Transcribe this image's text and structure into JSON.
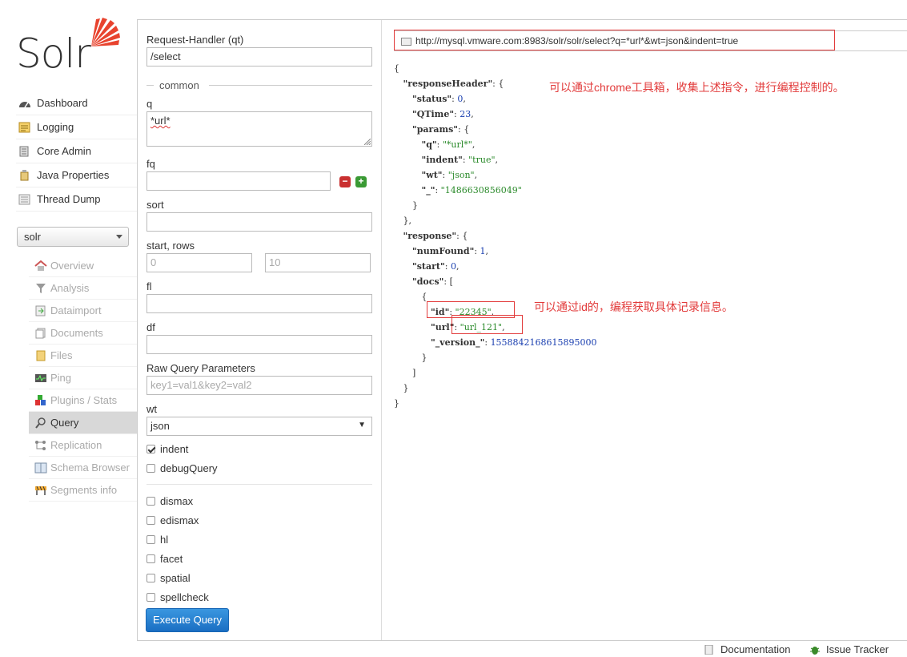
{
  "logo": {
    "text": "Solr"
  },
  "main_nav": [
    {
      "label": "Dashboard",
      "icon": "dashboard-icon"
    },
    {
      "label": "Logging",
      "icon": "logging-icon"
    },
    {
      "label": "Core Admin",
      "icon": "core-admin-icon"
    },
    {
      "label": "Java Properties",
      "icon": "java-icon"
    },
    {
      "label": "Thread Dump",
      "icon": "thread-dump-icon"
    }
  ],
  "core_selector": {
    "value": "solr"
  },
  "core_nav": [
    {
      "label": "Overview",
      "icon": "home-icon"
    },
    {
      "label": "Analysis",
      "icon": "filter-icon"
    },
    {
      "label": "Dataimport",
      "icon": "dataimport-icon"
    },
    {
      "label": "Documents",
      "icon": "documents-icon"
    },
    {
      "label": "Files",
      "icon": "files-icon"
    },
    {
      "label": "Ping",
      "icon": "ping-icon"
    },
    {
      "label": "Plugins / Stats",
      "icon": "plugins-icon"
    },
    {
      "label": "Query",
      "icon": "search-icon",
      "active": true
    },
    {
      "label": "Replication",
      "icon": "replication-icon"
    },
    {
      "label": "Schema Browser",
      "icon": "schema-icon"
    },
    {
      "label": "Segments info",
      "icon": "segments-icon"
    }
  ],
  "form": {
    "handler_label": "Request-Handler (qt)",
    "handler_value": "/select",
    "common_label": "common",
    "q_label": "q",
    "q_value": "*url*",
    "fq_label": "fq",
    "fq_value": "",
    "sort_label": "sort",
    "sort_value": "",
    "start_rows_label": "start, rows",
    "start_placeholder": "0",
    "rows_placeholder": "10",
    "fl_label": "fl",
    "fl_value": "",
    "df_label": "df",
    "df_value": "",
    "raw_label": "Raw Query Parameters",
    "raw_placeholder": "key1=val1&key2=val2",
    "wt_label": "wt",
    "wt_value": "json",
    "indent_label": "indent",
    "debug_label": "debugQuery",
    "dismax_label": "dismax",
    "edismax_label": "edismax",
    "hl_label": "hl",
    "facet_label": "facet",
    "spatial_label": "spatial",
    "spellcheck_label": "spellcheck",
    "execute_label": "Execute Query"
  },
  "result": {
    "url": "http://mysql.vmware.com:8983/solr/solr/select?q=*url*&wt=json&indent=true",
    "lines": [
      {
        "indent": 0,
        "text": "{"
      },
      {
        "indent": 1,
        "key": "\"responseHeader\"",
        "sep": ": {"
      },
      {
        "indent": 2,
        "key": "\"status\"",
        "sep": ": ",
        "num": "0",
        "end": ","
      },
      {
        "indent": 2,
        "key": "\"QTime\"",
        "sep": ": ",
        "num": "23",
        "end": ","
      },
      {
        "indent": 2,
        "key": "\"params\"",
        "sep": ": {"
      },
      {
        "indent": 3,
        "key": "\"q\"",
        "sep": ": ",
        "str": "\"*url*\"",
        "end": ","
      },
      {
        "indent": 3,
        "key": "\"indent\"",
        "sep": ": ",
        "str": "\"true\"",
        "end": ","
      },
      {
        "indent": 3,
        "key": "\"wt\"",
        "sep": ": ",
        "str": "\"json\"",
        "end": ","
      },
      {
        "indent": 3,
        "key": "\"_\"",
        "sep": ": ",
        "str": "\"1486630856049\""
      },
      {
        "indent": 2,
        "text": "}"
      },
      {
        "indent": 1,
        "text": "},"
      },
      {
        "indent": 1,
        "key": "\"response\"",
        "sep": ": {"
      },
      {
        "indent": 2,
        "key": "\"numFound\"",
        "sep": ": ",
        "num": "1",
        "end": ","
      },
      {
        "indent": 2,
        "key": "\"start\"",
        "sep": ": ",
        "num": "0",
        "end": ","
      },
      {
        "indent": 2,
        "key": "\"docs\"",
        "sep": ": ["
      },
      {
        "indent": 3,
        "text": "{"
      },
      {
        "indent": 4,
        "key": "\"id\"",
        "sep": ": ",
        "str": "\"22345\"",
        "end": ","
      },
      {
        "indent": 4,
        "key": "\"url\"",
        "sep": ": ",
        "str": "\"url_121\"",
        "end": ","
      },
      {
        "indent": 4,
        "key": "\"_version_\"",
        "sep": ": ",
        "num": "1558842168615895000"
      },
      {
        "indent": 3,
        "text": "}"
      },
      {
        "indent": 2,
        "text": "]"
      },
      {
        "indent": 1,
        "text": "}"
      },
      {
        "indent": 0,
        "text": "}"
      }
    ]
  },
  "annotations": {
    "note1": "可以通过chrome工具箱，收集上述指令，进行编程控制的。",
    "note2": "可以通过id的，编程获取具体记录信息。"
  },
  "footer": {
    "documentation": "Documentation",
    "issue_tracker": "Issue Tracker"
  },
  "colors": {
    "accent_blue": "#1a6ec2",
    "annotation_red": "#e23b3b",
    "json_string": "#2a8a2a",
    "json_number": "#1a3fb0",
    "logo_orange": "#e8432e"
  }
}
